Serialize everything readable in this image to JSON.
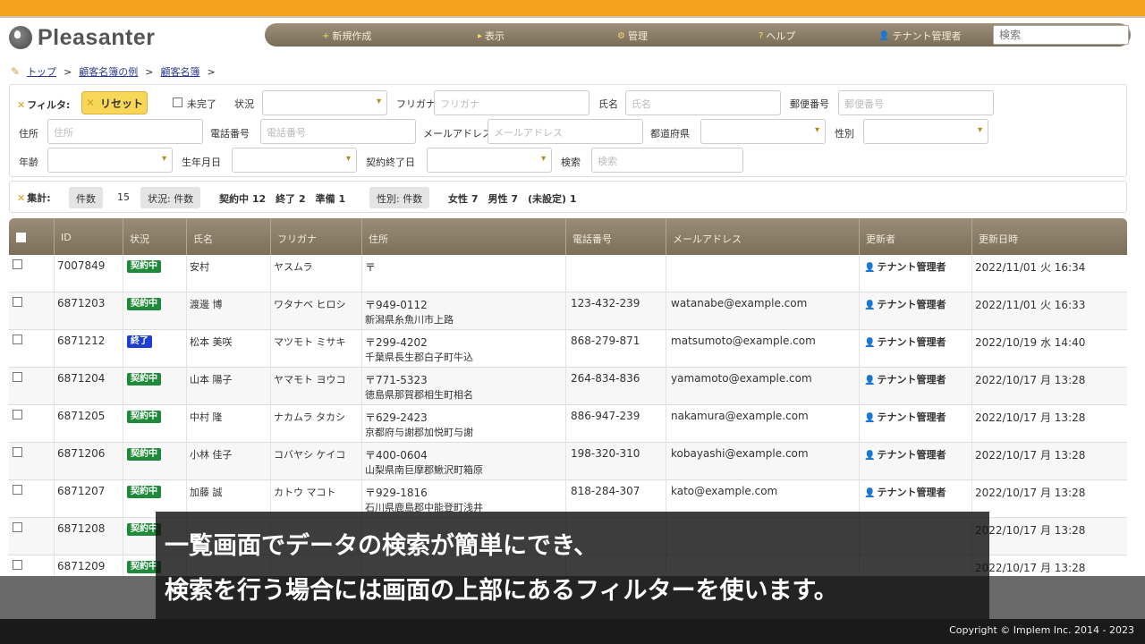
{
  "app": {
    "logo_text": "Pleasanter"
  },
  "nav": {
    "items": [
      {
        "icon": "+",
        "label": "新規作成"
      },
      {
        "icon": "▸",
        "label": "表示"
      },
      {
        "icon": "⚙",
        "label": "管理"
      },
      {
        "icon": "?",
        "label": "ヘルプ"
      },
      {
        "icon": "👤",
        "label": "テナント管理者"
      }
    ],
    "search_placeholder": "検索"
  },
  "breadcrumb": [
    "トップ",
    "顧客名簿の例",
    "顧客名簿"
  ],
  "filter": {
    "title": "フィルタ:",
    "reset_label": "リセット",
    "incomplete_label": "未完了",
    "status_label": "状況",
    "furigana_label": "フリガナ",
    "furigana_placeholder": "フリガナ",
    "name_label": "氏名",
    "name_placeholder": "氏名",
    "postal_label": "郵便番号",
    "postal_placeholder": "郵便番号",
    "address_label": "住所",
    "address_placeholder": "住所",
    "phone_label": "電話番号",
    "phone_placeholder": "電話番号",
    "email_label": "メールアドレス",
    "email_placeholder": "メールアドレス",
    "prefecture_label": "都道府県",
    "gender_label": "性別",
    "age_label": "年齢",
    "birthday_label": "生年月日",
    "contract_end_label": "契約終了日",
    "search_label": "検索",
    "search_placeholder": "検索"
  },
  "aggregation": {
    "title": "集計:",
    "count_chip": "件数",
    "count_value": "15",
    "status_chip": "状況: 件数",
    "status_items": "契約中 12　終了 2　準備 1",
    "gender_chip": "性別: 件数",
    "gender_items": "女性 7　男性 7　(未設定) 1"
  },
  "grid": {
    "columns": [
      "ID",
      "状況",
      "氏名",
      "フリガナ",
      "住所",
      "電話番号",
      "メールアドレス",
      "更新者",
      "更新日時"
    ],
    "rows": [
      {
        "id": "7007849",
        "status": "契約中",
        "status_color": "green",
        "name": "安村",
        "kana": "ヤスムラ",
        "zip": "〒",
        "addr": "",
        "phone": "",
        "email": "",
        "updater": "テナント管理者",
        "updated": "2022/11/01 火 16:34"
      },
      {
        "id": "6871203",
        "status": "契約中",
        "status_color": "green",
        "name": "渡邊 博",
        "kana": "ワタナベ ヒロシ",
        "zip": "〒949-0112",
        "addr": "新潟県糸魚川市上路",
        "phone": "123-432-239",
        "email": "watanabe@example.com",
        "updater": "テナント管理者",
        "updated": "2022/11/01 火 16:33"
      },
      {
        "id": "6871212",
        "status": "終了",
        "status_color": "blue",
        "name": "松本 美咲",
        "kana": "マツモト ミサキ",
        "zip": "〒299-4202",
        "addr": "千葉県長生郡白子町牛込",
        "phone": "868-279-871",
        "email": "matsumoto@example.com",
        "updater": "テナント管理者",
        "updated": "2022/10/19 水 14:40"
      },
      {
        "id": "6871204",
        "status": "契約中",
        "status_color": "green",
        "name": "山本 陽子",
        "kana": "ヤマモト ヨウコ",
        "zip": "〒771-5323",
        "addr": "徳島県那賀郡相生町相名",
        "phone": "264-834-836",
        "email": "yamamoto@example.com",
        "updater": "テナント管理者",
        "updated": "2022/10/17 月 13:28"
      },
      {
        "id": "6871205",
        "status": "契約中",
        "status_color": "green",
        "name": "中村 隆",
        "kana": "ナカムラ タカシ",
        "zip": "〒629-2423",
        "addr": "京都府与謝郡加悦町与謝",
        "phone": "886-947-239",
        "email": "nakamura@example.com",
        "updater": "テナント管理者",
        "updated": "2022/10/17 月 13:28"
      },
      {
        "id": "6871206",
        "status": "契約中",
        "status_color": "green",
        "name": "小林 佳子",
        "kana": "コバヤシ ケイコ",
        "zip": "〒400-0604",
        "addr": "山梨県南巨摩郡鰍沢町箱原",
        "phone": "198-320-310",
        "email": "kobayashi@example.com",
        "updater": "テナント管理者",
        "updated": "2022/10/17 月 13:28"
      },
      {
        "id": "6871207",
        "status": "契約中",
        "status_color": "green",
        "name": "加藤 誠",
        "kana": "カトウ マコト",
        "zip": "〒929-1816",
        "addr": "石川県鹿島郡中能登町浅井",
        "phone": "818-284-307",
        "email": "kato@example.com",
        "updater": "テナント管理者",
        "updated": "2022/10/17 月 13:28"
      },
      {
        "id": "6871208",
        "status": "契約中",
        "status_color": "green",
        "name": "",
        "kana": "",
        "zip": "",
        "addr": "",
        "phone": "",
        "email": "",
        "updater": "",
        "updated": "2022/10/17 月 13:28"
      },
      {
        "id": "6871209",
        "status": "契約中",
        "status_color": "green",
        "name": "",
        "kana": "",
        "zip": "",
        "addr": "",
        "phone": "",
        "email": "",
        "updater": "",
        "updated": "2022/10/17 月 13:28"
      }
    ]
  },
  "caption": {
    "line1": "一覧画面でデータの検索が簡単にでき、",
    "line2": "検索を行う場合には画面の上部にあるフィルターを使います。"
  },
  "footer": {
    "copyright": "Copyright © Implem Inc. 2014 - 2023"
  }
}
